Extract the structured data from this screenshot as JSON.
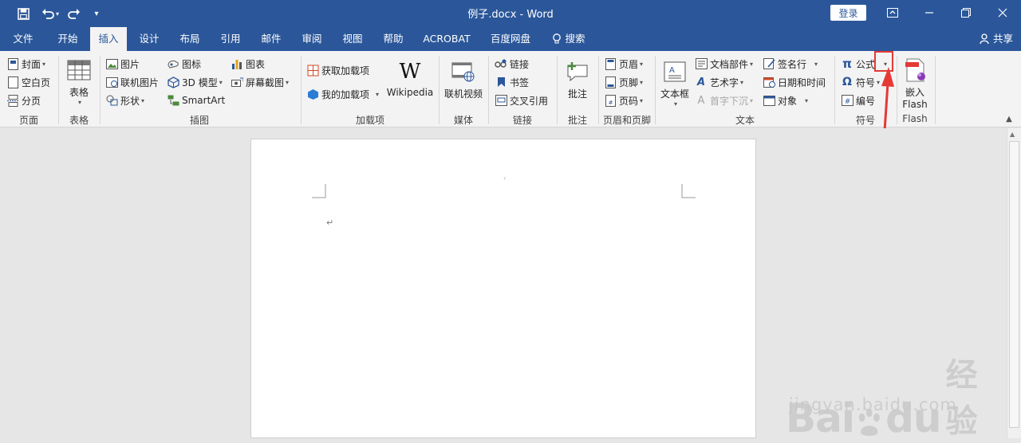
{
  "window": {
    "title": "例子.docx  -  Word",
    "login_label": "登录"
  },
  "tabs": [
    {
      "label": "文件"
    },
    {
      "label": "开始"
    },
    {
      "label": "插入"
    },
    {
      "label": "设计"
    },
    {
      "label": "布局"
    },
    {
      "label": "引用"
    },
    {
      "label": "邮件"
    },
    {
      "label": "审阅"
    },
    {
      "label": "视图"
    },
    {
      "label": "帮助"
    },
    {
      "label": "ACROBAT"
    },
    {
      "label": "百度网盘"
    },
    {
      "label": "搜索"
    }
  ],
  "share_label": "共享",
  "ribbon": {
    "pages": {
      "label": "页面",
      "items": [
        "封面",
        "空白页",
        "分页"
      ]
    },
    "tables": {
      "label": "表格",
      "button": "表格"
    },
    "illustrations": {
      "label": "插图",
      "items": [
        "图片",
        "联机图片",
        "形状",
        "图标",
        "3D 模型",
        "SmartArt",
        "图表",
        "屏幕截图"
      ]
    },
    "addins": {
      "label": "加载项",
      "items": [
        "获取加载项",
        "我的加载项"
      ],
      "wikipedia": "Wikipedia"
    },
    "media": {
      "label": "媒体",
      "button": "联机视频"
    },
    "links": {
      "label": "链接",
      "items": [
        "链接",
        "书签",
        "交叉引用"
      ]
    },
    "comments": {
      "label": "批注",
      "button": "批注"
    },
    "header_footer": {
      "label": "页眉和页脚",
      "items": [
        "页眉",
        "页脚",
        "页码"
      ]
    },
    "text": {
      "label": "文本",
      "textbox": "文本框",
      "items": [
        "文档部件",
        "艺术字",
        "首字下沉",
        "签名行",
        "日期和时间",
        "对象"
      ]
    },
    "symbols": {
      "label": "符号",
      "items": [
        "公式",
        "符号",
        "编号"
      ]
    },
    "flash": {
      "label": "Flash",
      "button_line1": "嵌入",
      "button_line2": "Flash"
    }
  },
  "document": {
    "paragraph_mark": "↵",
    "tiny_mark": "ˀ"
  },
  "watermark": {
    "brand": "Bai",
    "brand2": "du",
    "cn": "经验",
    "url": "jingyan.baidu.com"
  },
  "colors": {
    "title_bar": "#2b579a",
    "ribbon_bg": "#f3f3f3",
    "highlight": "#e53935"
  }
}
